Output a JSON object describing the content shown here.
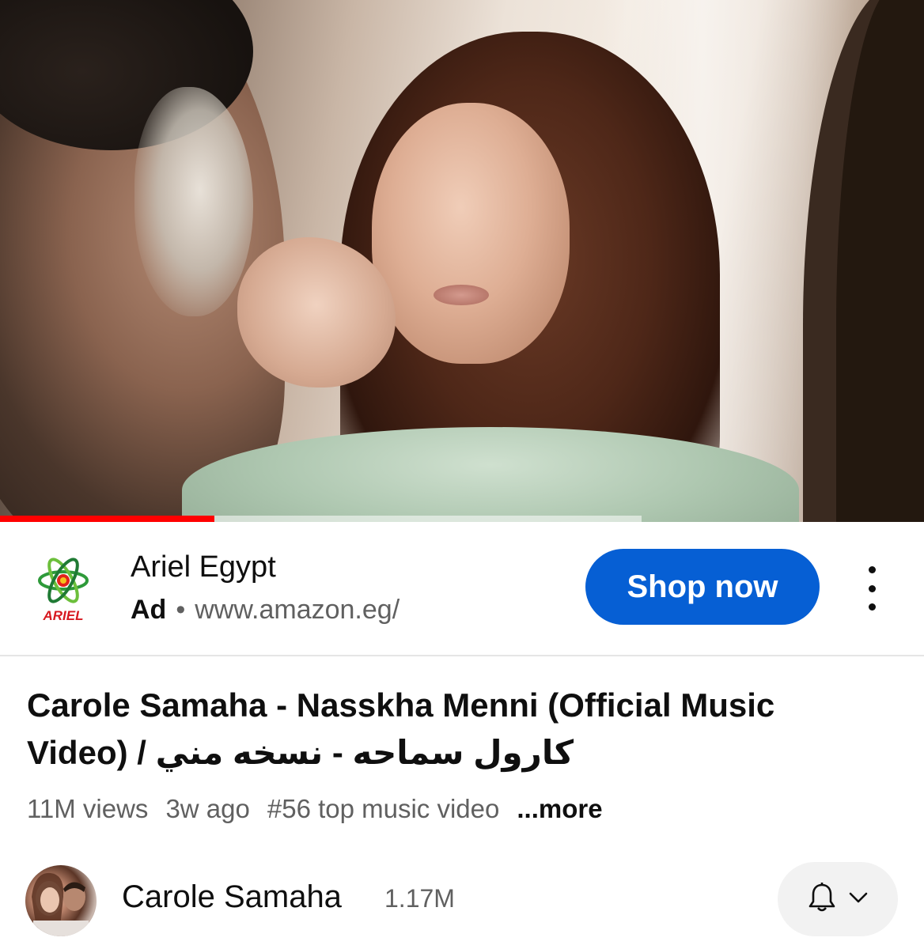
{
  "player": {
    "progress_fraction": 0.232,
    "buffered_fraction": 0.694,
    "progress_color": "#ff0000"
  },
  "ad": {
    "advertiser": "Ariel Egypt",
    "logo_text": "ARIEL",
    "label": "Ad",
    "separator": "•",
    "url": "www.amazon.eg/",
    "cta_label": "Shop now",
    "cta_color": "#065fd4",
    "menu_icon": "more-vertical-icon"
  },
  "video": {
    "title": "Carole Samaha - Nasskha Menni (Official Music Video) / كارول سماحه - نسخه مني",
    "views": "11M views",
    "age": "3w ago",
    "rank": "#56 top music video",
    "more": "...more"
  },
  "channel": {
    "name": "Carole Samaha",
    "subscribers": "1.17M",
    "bell_icon": "bell-icon",
    "chevron_icon": "chevron-down-icon"
  }
}
